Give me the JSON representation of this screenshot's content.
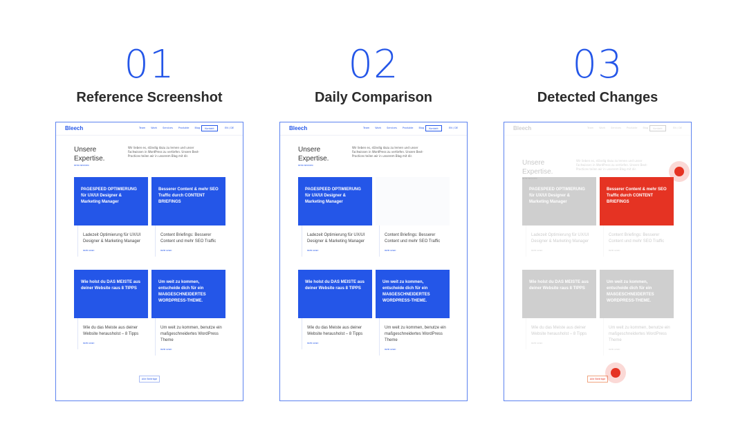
{
  "steps": [
    {
      "number": "01",
      "title": "Reference Screenshot"
    },
    {
      "number": "02",
      "title": "Daily Comparison"
    },
    {
      "number": "03",
      "title": "Detected Changes"
    }
  ],
  "site": {
    "logo": "Bleech",
    "nav": [
      "Team",
      "Work",
      "Services",
      "Produkte",
      "Blog"
    ],
    "kontakt": "Kontakt",
    "lang": "EN / DE",
    "hero_title_line1": "Unsere",
    "hero_title_line2": "Expertise.",
    "hero_more": "MEHR ERFAHREN",
    "hero_text": "Wir lieben es, ständig dazu zu lernen und unser Fachwissen in WordPress zu vertiefen. Unsere Best-Practices teilen wir in unserem Blog mit dir.",
    "read_more": "MEHR LESEN",
    "all_posts": "Alle Beiträge",
    "cards": [
      {
        "caption": "Ladezeit Optimierung für UX/UI Designer & Marketing Manager",
        "image_text": "PAGESPEED OPTIMIERUNG für UX/UI Designer & Marketing Manager"
      },
      {
        "caption": "Content Briefings: Besserer Content und mehr SEO Traffic",
        "image_text": "Besserer Content & mehr SEO Traffic durch CONTENT BRIEFINGS"
      },
      {
        "caption": "Wie du das Meiste aus deiner Website herausholst – 8 Tipps",
        "image_text": "Wie holst du DAS MEISTE aus deiner Website raus 8 TIPPS"
      },
      {
        "caption": "Um weit zu kommen, benutze ein maßgeschneidertes WordPress Theme",
        "image_text": "Um weit zu kommen, entscheide dich für ein MAßGESCHNEIDERTES WORDPRESS-THEME."
      }
    ]
  },
  "colors": {
    "accent": "#2456e8",
    "change": "#e53323",
    "frame": "#5b82f0"
  }
}
